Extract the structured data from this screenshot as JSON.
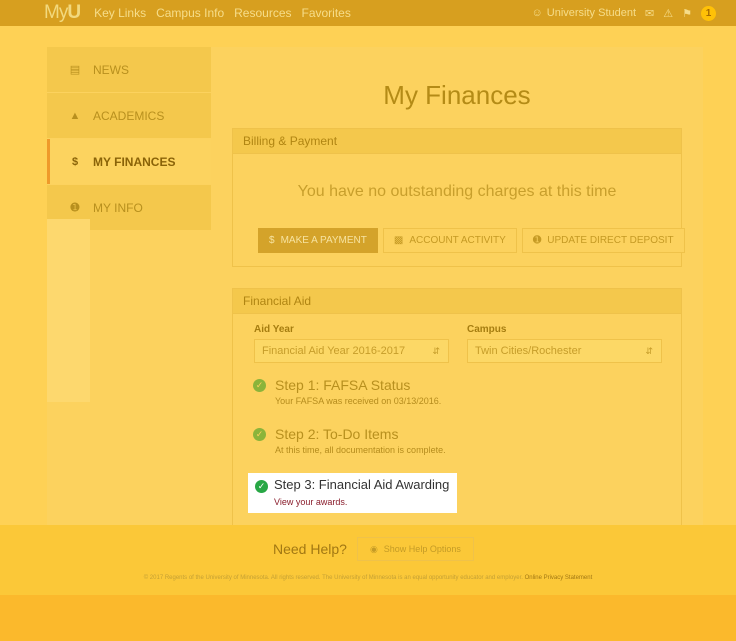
{
  "header": {
    "logo": "MyU",
    "nav": [
      "Key Links",
      "Campus Info",
      "Resources",
      "Favorites"
    ],
    "user": "University Student",
    "notification_count": "1"
  },
  "sidebar": {
    "items": [
      {
        "label": "NEWS",
        "icon": "newspaper-icon"
      },
      {
        "label": "ACADEMICS",
        "icon": "graduation-cap-icon"
      },
      {
        "label": "MY FINANCES",
        "icon": "dollar-icon"
      },
      {
        "label": "MY INFO",
        "icon": "info-icon"
      }
    ],
    "active": "MY FINANCES"
  },
  "main": {
    "title": "My Finances",
    "billing": {
      "header": "Billing & Payment",
      "message": "You have no outstanding charges at this time",
      "buttons": {
        "payment": "MAKE A PAYMENT",
        "activity": "ACCOUNT ACTIVITY",
        "deposit": "UPDATE DIRECT DEPOSIT"
      }
    },
    "financial_aid": {
      "header": "Financial Aid",
      "aid_year_label": "Aid Year",
      "aid_year_value": "Financial Aid Year 2016-2017",
      "campus_label": "Campus",
      "campus_value": "Twin Cities/Rochester",
      "steps": [
        {
          "title": "Step 1: FAFSA Status",
          "desc": "Your FAFSA was received on 03/13/2016."
        },
        {
          "title": "Step 2: To-Do Items",
          "desc": "At this time, all documentation is complete."
        },
        {
          "title": "Step 3: Financial Aid Awarding",
          "desc": "View your awards."
        }
      ]
    }
  },
  "footer": {
    "help_title": "Need Help?",
    "help_button": "Show Help Options",
    "copyright": "© 2017 Regents of the University of Minnesota. All rights reserved. The University of Minnesota is an equal opportunity educator and employer.",
    "privacy": "Online Privacy Statement"
  },
  "colors": {
    "overlay": "#fed155",
    "accent": "#ef9a2a",
    "highlight_bg": "#ffffff",
    "success": "#28a745",
    "link": "#8a1e2d"
  }
}
